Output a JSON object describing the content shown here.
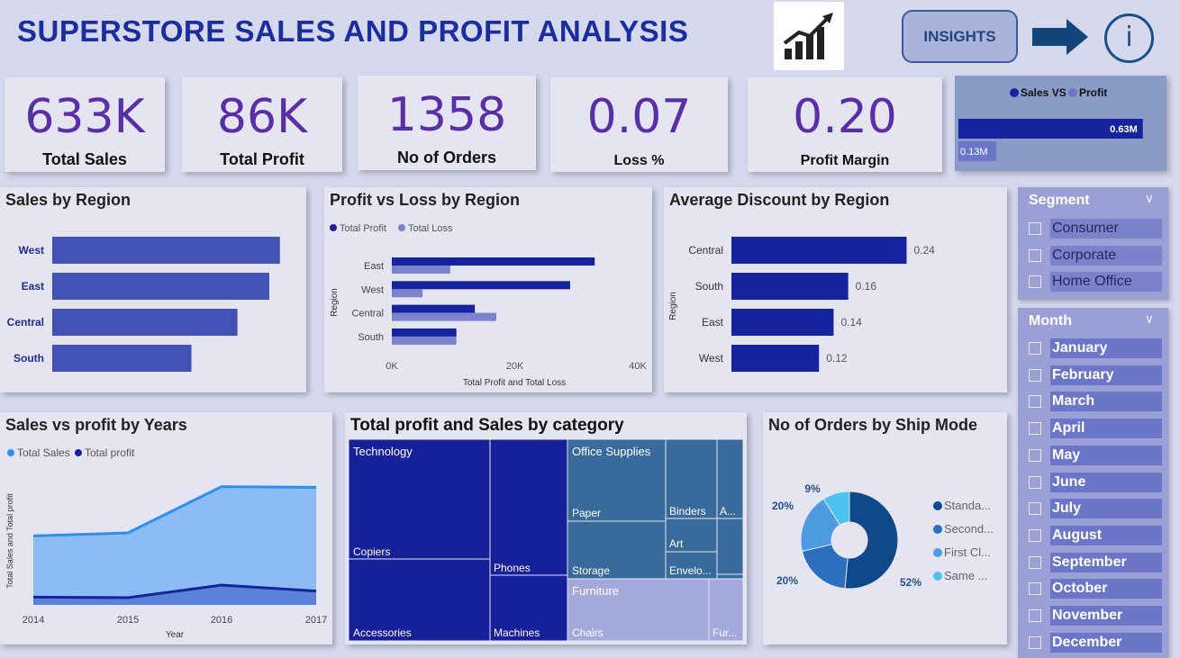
{
  "header": {
    "title": "SUPERSTORE SALES AND PROFIT ANALYSIS",
    "insights_label": "INSIGHTS",
    "logo_icon": "trending-chart-icon",
    "arrow_icon": "arrow-right-icon",
    "info_icon": "info-icon",
    "info_glyph": "i"
  },
  "kpis": [
    {
      "value": "633K",
      "label": "Total Sales"
    },
    {
      "value": "86K",
      "label": "Total Profit"
    },
    {
      "value": "1358",
      "label": "No of Orders"
    },
    {
      "value": "0.07",
      "label": "Loss %"
    },
    {
      "value": "0.20",
      "label": "Profit Margin"
    }
  ],
  "segment": {
    "title": "Segment",
    "options": [
      "Consumer",
      "Corporate",
      "Home Office"
    ]
  },
  "month": {
    "title": "Month",
    "options": [
      "January",
      "February",
      "March",
      "April",
      "May",
      "June",
      "July",
      "August",
      "September",
      "October",
      "November",
      "December"
    ]
  },
  "colors": {
    "navy": "#16239e",
    "mid": "#4552b5",
    "light": "#7a83cc",
    "area_light": "#8cbcf3",
    "sales_line": "#2b8ff0",
    "profit_line": "#16239e"
  },
  "chart_data": [
    {
      "id": "sales_vs_profit_bar",
      "type": "bar",
      "legend": [
        "Sales VS",
        "Profit"
      ],
      "values": [
        0.63,
        0.13
      ],
      "data_labels": [
        "0.63M",
        "0.13M"
      ],
      "xlim": [
        0,
        0.8
      ]
    },
    {
      "id": "sales_by_region",
      "type": "bar",
      "title": "Sales by Region",
      "categories": [
        "West",
        "East",
        "Central",
        "South"
      ],
      "values": [
        193000,
        184000,
        157000,
        118000
      ],
      "xlim": [
        0,
        210000
      ]
    },
    {
      "id": "profit_loss_region",
      "type": "bar",
      "title": "Profit vs Loss by Region",
      "ylabel": "Region",
      "xlabel": "Total Profit and Total Loss",
      "categories": [
        "East",
        "West",
        "Central",
        "South"
      ],
      "series": [
        {
          "name": "Total Profit",
          "values": [
            33000,
            29000,
            13500,
            10500
          ]
        },
        {
          "name": "Total Loss",
          "values": [
            9500,
            5000,
            17000,
            10500
          ]
        }
      ],
      "ticks": [
        "0K",
        "20K",
        "40K"
      ],
      "xlim": [
        0,
        40000
      ]
    },
    {
      "id": "avg_discount_region",
      "type": "bar",
      "title": "Average Discount by Region",
      "ylabel": "Region",
      "categories": [
        "Central",
        "South",
        "East",
        "West"
      ],
      "values": [
        0.24,
        0.16,
        0.14,
        0.12
      ],
      "data_labels": [
        "0.24",
        "0.16",
        "0.14",
        "0.12"
      ],
      "xlim": [
        0,
        0.29
      ]
    },
    {
      "id": "sales_profit_years",
      "type": "area",
      "title": "Sales vs profit by Years",
      "xlabel": "Year",
      "ylabel": "Total Sales and Total profit",
      "x": [
        "2014",
        "2015",
        "2016",
        "2017"
      ],
      "series": [
        {
          "name": "Total Sales",
          "values": [
            115000,
            120000,
            197000,
            196000
          ]
        },
        {
          "name": "Total profit",
          "values": [
            13000,
            12000,
            33000,
            23000
          ]
        }
      ],
      "ylim": [
        0,
        210000
      ]
    },
    {
      "id": "category_treemap",
      "type": "treemap",
      "title": "Total profit and Sales by category",
      "labels": [
        "Technology",
        "Copiers",
        "Accessories",
        "Phones",
        "Machines",
        "Office Supplies",
        "Paper",
        "Binders",
        "A...",
        "Art",
        "Storage",
        "Envelo...",
        "Furniture",
        "Chairs",
        "Fur..."
      ]
    },
    {
      "id": "orders_ship_mode",
      "type": "pie",
      "title": "No of Orders by Ship Mode",
      "categories": [
        "Standa...",
        "Second...",
        "First Cl...",
        "Same ..."
      ],
      "values": [
        52,
        20,
        20,
        9
      ],
      "data_labels": [
        "52%",
        "20%",
        "20%",
        "9%"
      ],
      "colors": [
        "#0e4a8a",
        "#2a6fbd",
        "#4d9ae0",
        "#4cc3ef"
      ]
    }
  ]
}
